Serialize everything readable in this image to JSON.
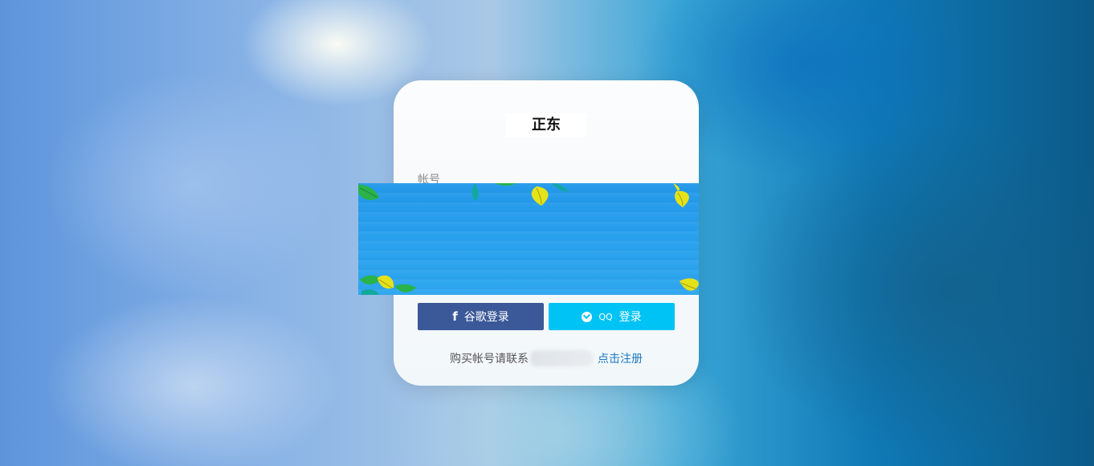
{
  "title": "正东",
  "form": {
    "account_label": "帐号"
  },
  "buttons": {
    "google_icon": "f",
    "google_label": "谷歌登录",
    "qq_badge": "QQ",
    "qq_label": "登录"
  },
  "footer": {
    "text": "购买帐号请联系",
    "register_link": "点击注册"
  },
  "colors": {
    "google_button": "#3b5998",
    "qq_button": "#00c3f5",
    "link": "#1a78c2",
    "banner": "#2aa2ee"
  }
}
